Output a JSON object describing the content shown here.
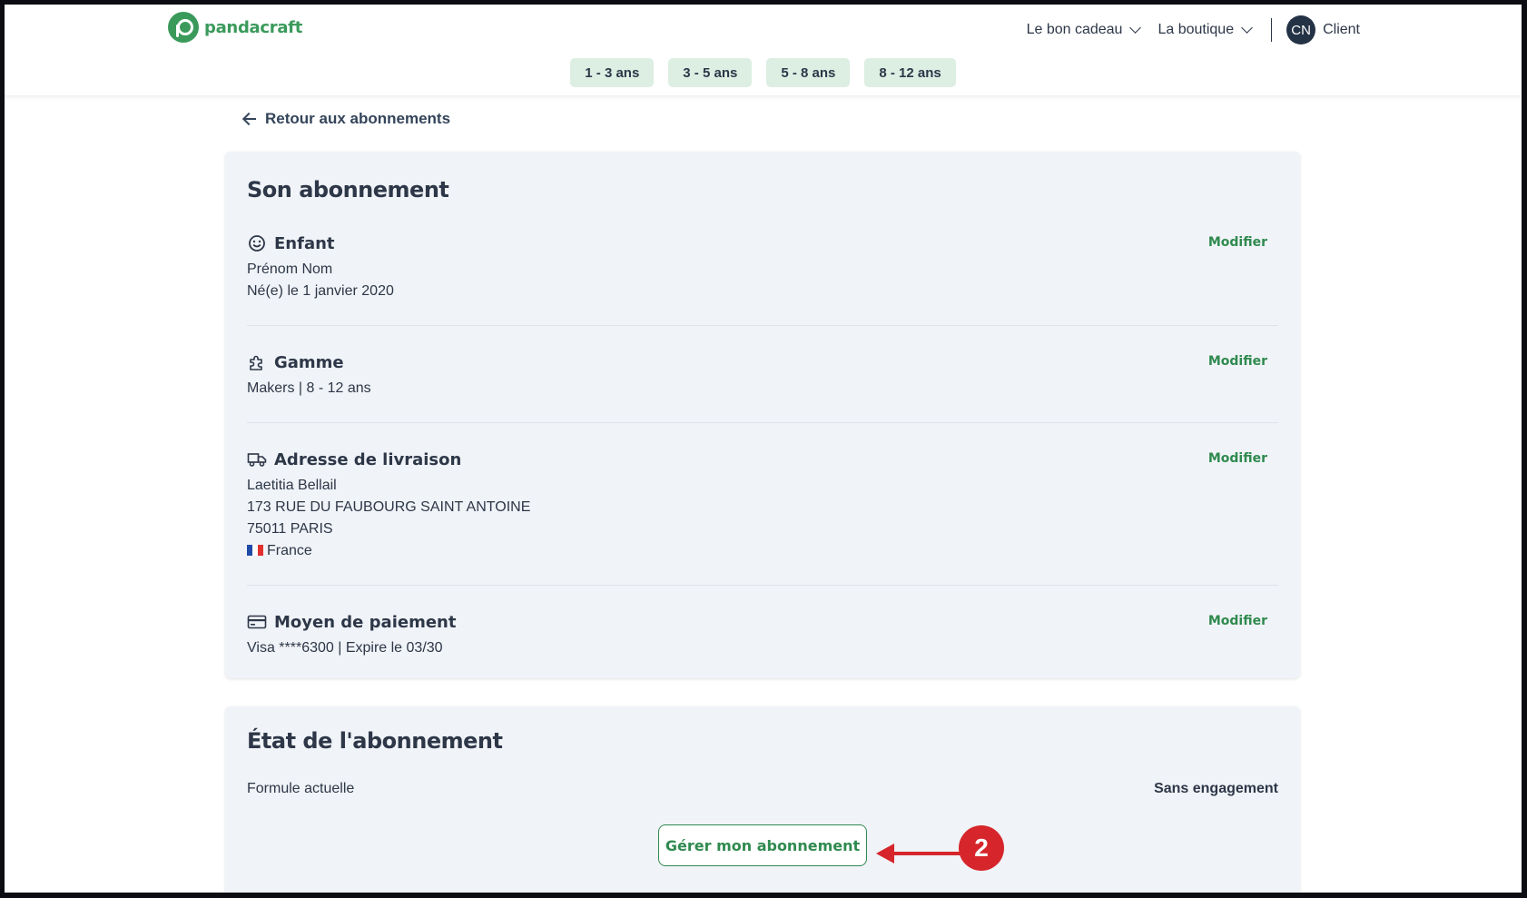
{
  "brand": {
    "name": "pandacraft",
    "color": "#3a9a5b"
  },
  "nav": {
    "gift": "Le bon cadeau",
    "shop": "La boutique",
    "avatar_initials": "CN",
    "user": "Client"
  },
  "age_tabs": [
    "1 - 3 ans",
    "3 - 5 ans",
    "5 - 8 ans",
    "8 - 12 ans"
  ],
  "back_link": "Retour aux abonnements",
  "subscription": {
    "title": "Son abonnement",
    "modify_label": "Modifier",
    "child": {
      "title": "Enfant",
      "icon": "smiley-icon",
      "lines": [
        "Prénom Nom",
        "Né(e) le 1 janvier 2020"
      ]
    },
    "range": {
      "title": "Gamme",
      "icon": "puzzle-icon",
      "lines": [
        "Makers | 8 - 12 ans"
      ]
    },
    "address": {
      "title": "Adresse de livraison",
      "icon": "truck-icon",
      "lines": [
        "Laetitia Bellail",
        "173 RUE DU FAUBOURG SAINT ANTOINE",
        "75011 PARIS"
      ],
      "country": "France"
    },
    "payment": {
      "title": "Moyen de paiement",
      "icon": "credit-card-icon",
      "lines": [
        "Visa ****6300 | Expire le 03/30"
      ]
    }
  },
  "status": {
    "title": "État de l'abonnement",
    "formula_label": "Formule actuelle",
    "formula_value": "Sans engagement",
    "manage_button": "Gérer mon abonnement"
  },
  "annotation": {
    "step": "2",
    "color": "#d6262b"
  }
}
